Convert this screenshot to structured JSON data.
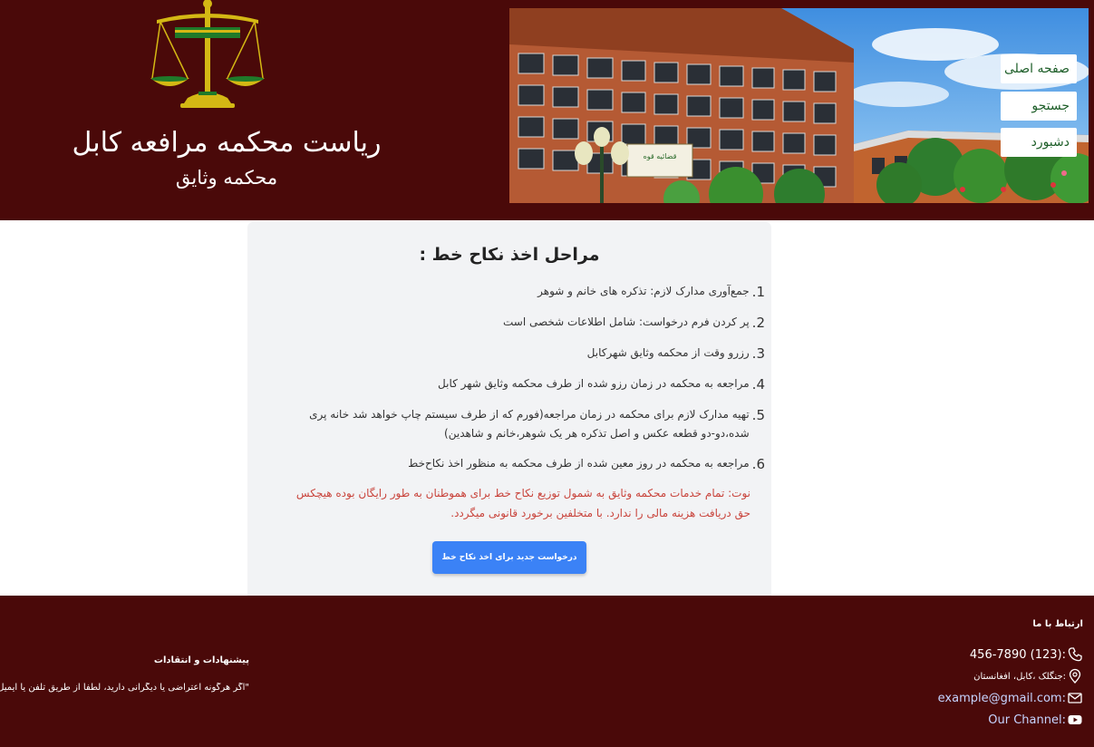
{
  "header": {
    "title": "ریاست محکمه مرافعه کابل",
    "subtitle": "محکمه وثایق",
    "emblem_text": "قوه قضائیه",
    "building_sign": "قضائیه قوه",
    "colors": {
      "background": "#4a0909",
      "scale_gold": "#d4b814",
      "scale_green": "#1f7a2a"
    }
  },
  "nav": {
    "items": [
      {
        "label": "صفحه اصلی",
        "icon": ""
      },
      {
        "label": "جستجو",
        "icon": ""
      },
      {
        "label": "دشبورد",
        "icon": ""
      }
    ]
  },
  "main": {
    "title": "مراحل اخذ نکاح خط :",
    "steps": [
      {
        "num": "1.",
        "text": "جمع‌آوری مدارک لازم: تذکره های خانم و شوهر"
      },
      {
        "num": "2.",
        "text": "پر کردن فرم درخواست: شامل اطلاعات شخصی است"
      },
      {
        "num": "3.",
        "text": "رزرو وقت از محکمه وثایق شهرکابل"
      },
      {
        "num": "4.",
        "text": "مراجعه به محکمه در زمان رزو شده از طرف محکمه وثایق شهر کابل"
      },
      {
        "num": "5.",
        "text": "تهیه مدارک لازم برای محکمه در زمان مراجعه(فورم که از طرف سیستم چاپ خواهد شد خانه پری شده،دو-دو قطعه عکس و اصل تذکره هر یک شوهر،خانم و شاهدین)"
      },
      {
        "num": "6.",
        "text": "مراجعه به محکمه در روز معین شده از طرف محکمه به منظور اخذ نکاح‌خط"
      }
    ],
    "note": "نوت: تمام خدمات محکمه وثایق به شمول توزیع نکاح خط برای هموطنان به طور رایگان بوده هیچکس حق دریافت هزینه مالی را ندارد. با متخلفین برخورد قانونی میگردد.",
    "apply_button": "درخواست جدید برای اخذ نکاح خط",
    "colors": {
      "card": "#f2f3f5",
      "note": "#c9453d",
      "button": "#3b82f6"
    }
  },
  "footer": {
    "contact_title": "ارتباط با ما",
    "phone": ":(123) 456-7890",
    "address": ":جنگلک ،کابل، افغانستان",
    "email": ":example@gmail.com",
    "channel": ":Our Channel",
    "suggestions_title": "پیشنهادات و انتقادات",
    "suggestions_text": "\"اگر هرگونه اعتراضی یا دیگرانی دارید، لطفاً از طریق تلفن یا ایمیل با ما در تماس شوید\""
  }
}
